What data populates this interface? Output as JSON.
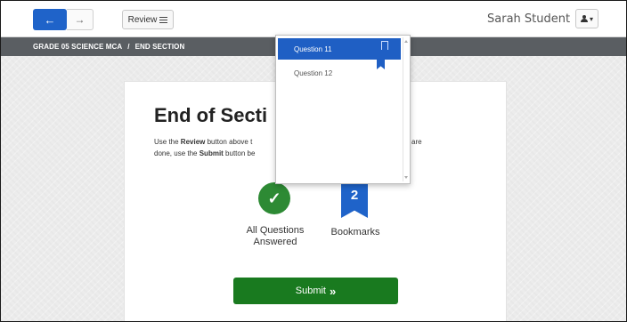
{
  "toolbar": {
    "back_icon": "arrow-left-icon",
    "back_glyph": "←",
    "forward_icon": "arrow-right-icon",
    "forward_glyph": "→",
    "review_label": "Review",
    "review_icon": "list-icon",
    "user_name": "Sarah Student",
    "user_icon": "user-icon",
    "caret_glyph": "▾"
  },
  "breadcrumb": {
    "test": "GRADE 05 SCIENCE MCA",
    "separator": "/",
    "section": "END SECTION"
  },
  "main": {
    "title": "End of Secti",
    "desc_part1": "Use the ",
    "desc_review": "Review",
    "desc_part2": " button above t",
    "desc_part3": "hen you are",
    "desc_part4": "done, use the ",
    "desc_submit": "Submit",
    "desc_part5": " button be",
    "answered_glyph": "✓",
    "answered_label": "All Questions Answered",
    "bookmarks_count": "2",
    "bookmarks_label": "Bookmarks",
    "submit_label": "Submit",
    "submit_glyph": "»"
  },
  "review_dropdown": {
    "items": [
      {
        "label": "Question 11",
        "selected": true,
        "bookmarked": true
      },
      {
        "label": "Question 12",
        "selected": false,
        "bookmarked": false
      }
    ]
  },
  "colors": {
    "accent_blue": "#1f63c9",
    "success_green": "#197a1f",
    "breadcrumb_bg": "#5a5e62"
  }
}
